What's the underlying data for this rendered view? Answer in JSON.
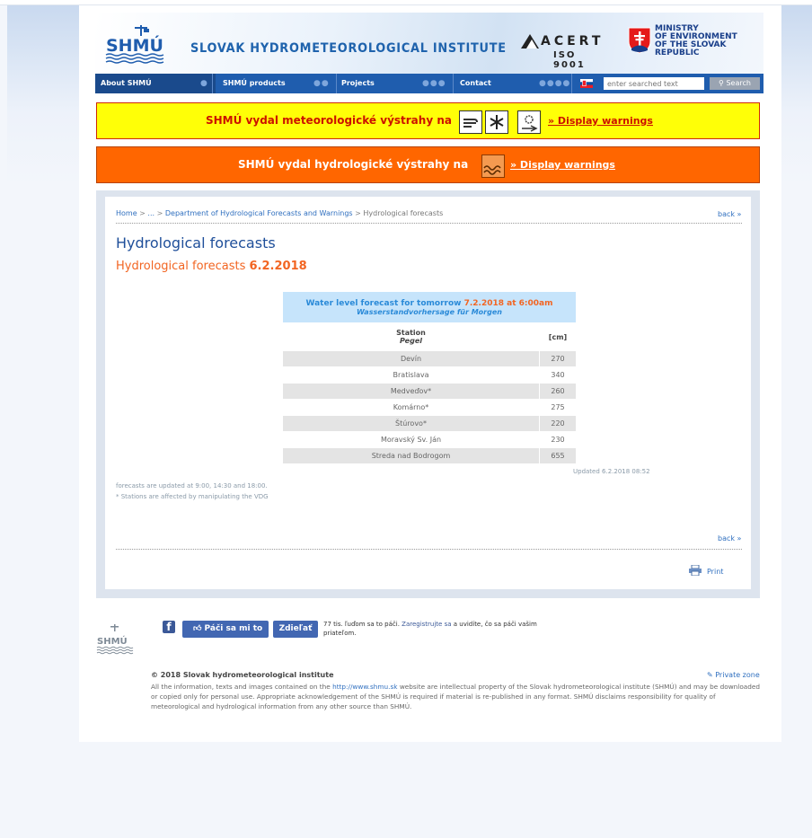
{
  "header": {
    "site_title": "SLOVAK HYDROMETEOROLOGICAL INSTITUTE",
    "logo_text": "SHMÚ",
    "acert_name": "ACERT",
    "acert_iso": "ISO 9001",
    "ministry_lines": [
      "MINISTRY",
      "OF ENVIRONMENT",
      "OF THE SLOVAK REPUBLIC"
    ]
  },
  "nav": {
    "items": [
      {
        "label": "About SHMÚ"
      },
      {
        "label": "SHMÚ products"
      },
      {
        "label": "Projects"
      },
      {
        "label": "Contact"
      }
    ],
    "search_placeholder": "enter searched text",
    "search_button": "Search"
  },
  "warnings": {
    "meteorological_text": "SHMÚ vydal meteorologické výstrahy na",
    "meteorological_link": "» Display warnings",
    "meteorological_icons": [
      "wind-warning-icon",
      "frost-warning-icon",
      "snow-warning-icon"
    ],
    "hydrological_text": "SHMÚ vydal hydrologické výstrahy na",
    "hydrological_link": "» Display warnings",
    "colors": {
      "meteorological": "#ffff07",
      "hydrological": "#ff6600"
    }
  },
  "breadcrumb": {
    "home": "Home",
    "ellipsis": "...",
    "parent": "Department of Hydrological Forecasts and Warnings",
    "current": "Hydrological forecasts",
    "sep": ">"
  },
  "back_label": "back »",
  "page_title": "Hydrological forecasts",
  "sub_title_prefix": "Hydrological forecasts",
  "sub_title_date": "6.2.2018",
  "forecast_table": {
    "title_prefix": "Water level forecast for tomorrow",
    "title_date": "7.2.2018 at 6:00am",
    "title_de": "Wasserstandvorhersage für Morgen",
    "col_station": "Station",
    "col_station_de": "Pegel",
    "col_unit": "[cm]",
    "rows": [
      {
        "station": "Devín",
        "value": "270"
      },
      {
        "station": "Bratislava",
        "value": "340"
      },
      {
        "station": "Medveďov*",
        "value": "260"
      },
      {
        "station": "Komárno*",
        "value": "275"
      },
      {
        "station": "Štúrovo*",
        "value": "220"
      },
      {
        "station": "Moravský Sv. Ján",
        "value": "230"
      },
      {
        "station": "Streda nad Bodrogom",
        "value": "655"
      }
    ]
  },
  "updated": "Updated 6.2.2018 08:52",
  "notes": {
    "update_times": "forecasts are updated at 9:00, 14:30 and 18:00.",
    "stations_note": "* Stations are affected by manipulating the VDG"
  },
  "print_label": "Print",
  "footer": {
    "fb_icon": "f",
    "like_label": "Páči sa mi to",
    "share_label": "Zdieľať",
    "social_text_1": "77 tis. ľuďom sa to páči.",
    "social_link": "Zaregistrujte sa",
    "social_text_2": "a uvidíte, čo sa páči vašim priateľom.",
    "copyright": "© 2018 Slovak hydrometeorological institute",
    "private_zone": "Private zone",
    "legal_1": "All the information, texts and images contained on the",
    "legal_link": "http://www.shmu.sk",
    "legal_2": "website are intellectual property of the Slovak hydrometeorological institute (SHMÚ) and may be downloaded or copied only for personal use. Appropriate acknowledgement of the SHMÚ is required if material is re-published in any format. SHMÚ disclaims responsibility for quality of meteorological and hydrological information from any other source than SHMÚ."
  }
}
